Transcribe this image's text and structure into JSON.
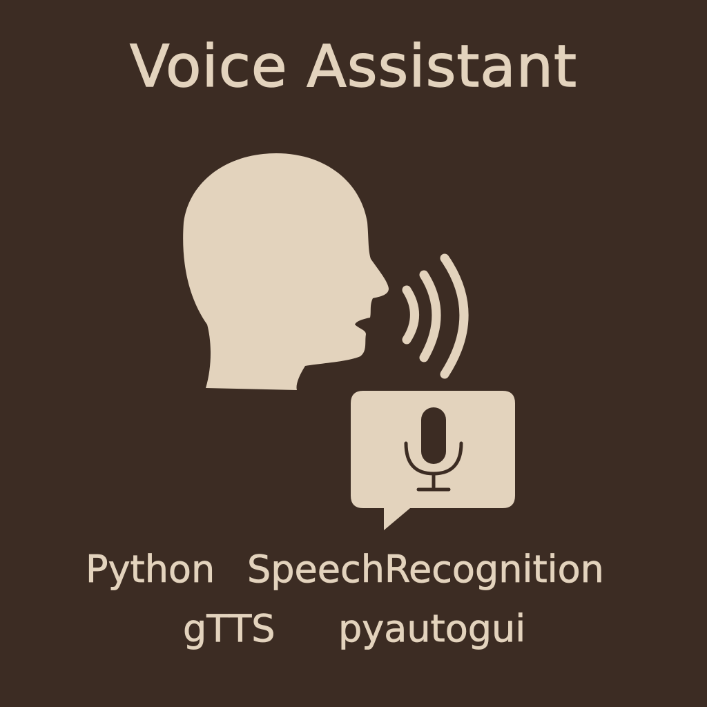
{
  "title": "Voice Assistant",
  "tags": [
    "Python",
    "SpeechRecognition",
    "gTTS",
    "pyautogui"
  ],
  "icons": {
    "head": "speaking-head-icon",
    "waves": "sound-waves-icon",
    "bubble": "speech-bubble-icon",
    "mic": "microphone-icon"
  },
  "colors": {
    "background": "#3c2c23",
    "foreground": "#e3d3bd"
  }
}
